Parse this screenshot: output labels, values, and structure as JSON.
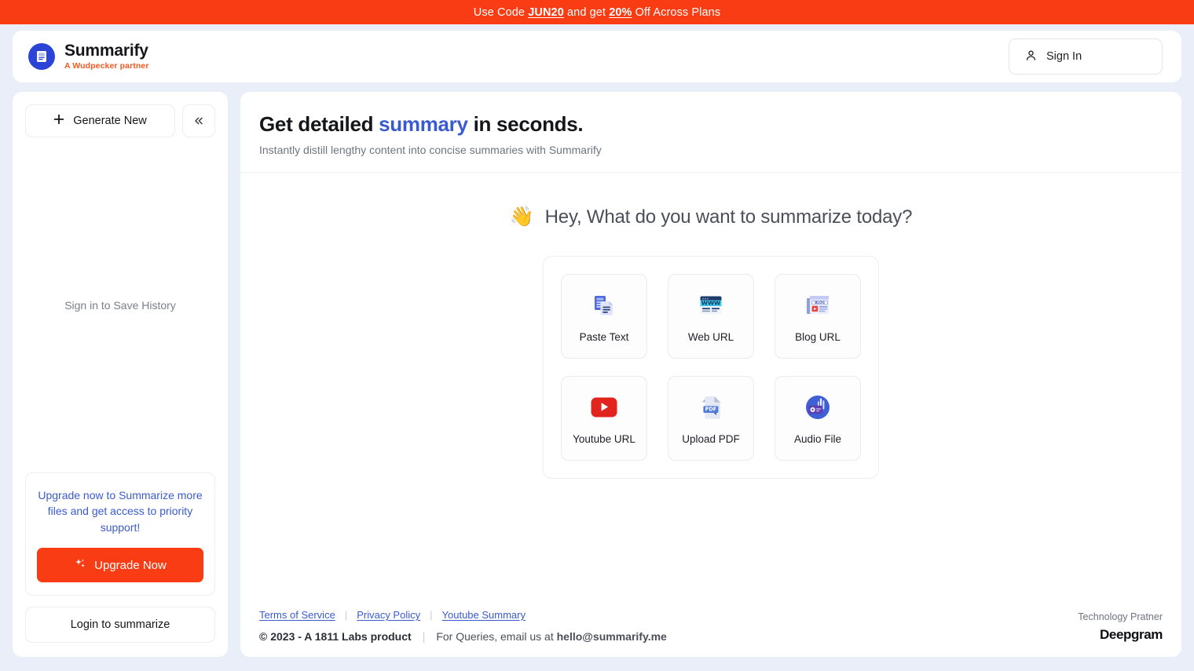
{
  "promo": {
    "prefix": "Use Code ",
    "code": "JUN20",
    "middle": " and get ",
    "discount": "20%",
    "suffix": " Off Across Plans",
    "bg_color": "#f93c13"
  },
  "header": {
    "brand_name": "Summarify",
    "brand_subtitle": "A Wudpecker partner",
    "logo_icon": "document-logo-icon",
    "signin_label": "Sign In",
    "signin_icon": "user-icon"
  },
  "sidebar": {
    "generate_label": "Generate New",
    "generate_icon": "plus-icon",
    "collapse_icon": "chevrons-left-icon",
    "history_empty": "Sign in to Save History",
    "upgrade_text": "Upgrade now to Summarize more files and get access to priority support!",
    "upgrade_button": "Upgrade Now",
    "upgrade_icon": "sparkles-icon",
    "login_label": "Login to summarize"
  },
  "main": {
    "title_prefix": "Get detailed ",
    "title_accent": "summary",
    "title_suffix": " in seconds.",
    "subtitle": "Instantly distill lengthy content into concise summaries with Summarify",
    "greeting_emoji": "👋",
    "greeting": "Hey, What do you want to summarize today?",
    "options": [
      {
        "label": "Paste Text",
        "icon": "paste-text-icon"
      },
      {
        "label": "Web URL",
        "icon": "web-url-icon"
      },
      {
        "label": "Blog URL",
        "icon": "blog-url-icon"
      },
      {
        "label": "Youtube URL",
        "icon": "youtube-icon"
      },
      {
        "label": "Upload PDF",
        "icon": "pdf-file-icon"
      },
      {
        "label": "Audio File",
        "icon": "audio-file-icon"
      }
    ]
  },
  "footer": {
    "links": [
      {
        "label": "Terms of Service"
      },
      {
        "label": "Privacy Policy"
      },
      {
        "label": "Youtube Summary"
      }
    ],
    "divider": "|",
    "copyright": "© 2023 - A 1811 Labs product",
    "queries_prefix": "For Queries, email us at ",
    "email": "hello@summarify.me",
    "partner_label": "Technology Pratner",
    "partner_name": "Deepgram"
  },
  "colors": {
    "accent_blue": "#3a5bd0",
    "accent_orange": "#f93c13",
    "page_bg": "#e9eef8"
  }
}
